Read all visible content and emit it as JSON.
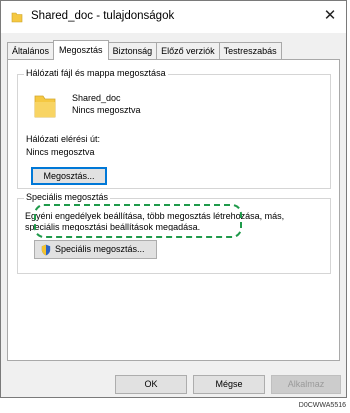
{
  "window": {
    "title": "Shared_doc - tulajdonságok",
    "close_glyph": "✕"
  },
  "tabs": [
    {
      "label": "Általános",
      "active": false
    },
    {
      "label": "Megosztás",
      "active": true
    },
    {
      "label": "Biztonság",
      "active": false
    },
    {
      "label": "Előző verziók",
      "active": false
    },
    {
      "label": "Testreszabás",
      "active": false
    }
  ],
  "network_sharing": {
    "group_title": "Hálózati fájl és mappa megosztása",
    "folder_icon": "folder-icon",
    "folder_name": "Shared_doc",
    "folder_status": "Nincs megosztva",
    "path_label": "Hálózati elérési út:",
    "path_value": "Nincs megosztva",
    "share_button": "Megosztás..."
  },
  "advanced_sharing": {
    "group_title": "Speciális megosztás",
    "description_line1": "Egyéni engedélyek beállítása, több megosztás létrehozása, más,",
    "description_line2": "speciális megosztási beállítások megadása.",
    "button_label": "Speciális megosztás...",
    "shield_icon": "shield-icon"
  },
  "footer": {
    "ok": "OK",
    "cancel": "Mégse",
    "apply": "Alkalmaz"
  },
  "colors": {
    "highlight": "#1f9a4a",
    "focus": "#0078d7",
    "folder": "#f5c842"
  },
  "image_code": "D0CWWA5516"
}
